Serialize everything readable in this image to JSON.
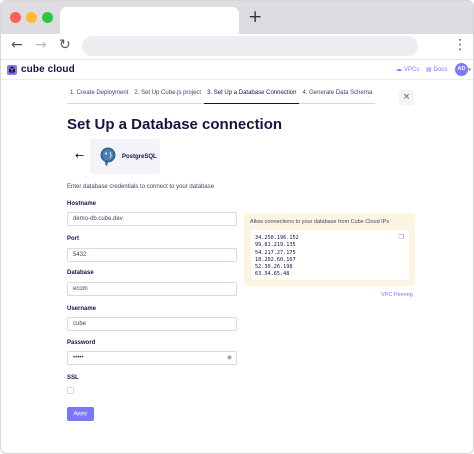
{
  "browser": {
    "new_tab": "+",
    "back": "←",
    "forward": "→",
    "reload": "↻",
    "menu": "⋮"
  },
  "header": {
    "logo_text": "cube cloud",
    "links": [
      {
        "label": "VPCs",
        "icon": "vpc-icon"
      },
      {
        "label": "Docs",
        "icon": "docs-icon"
      }
    ],
    "avatar": "AD"
  },
  "steps": [
    {
      "label": "1. Create Deployment",
      "active": false
    },
    {
      "label": "2. Set Up Cube.js project",
      "active": false
    },
    {
      "label": "3. Set Up a Database Connection",
      "active": true
    },
    {
      "label": "4. Generate Data Schema",
      "active": false
    }
  ],
  "close": "×",
  "title": "Set Up a Database connection",
  "database": {
    "name": "PostgreSQL",
    "back": "←"
  },
  "intro": "Enter database credentials to connect to your database",
  "fields": {
    "hostname": {
      "label": "Hostname",
      "value": "demo-db.cube.dev"
    },
    "port": {
      "label": "Port",
      "value": "5432"
    },
    "database": {
      "label": "Database",
      "value": "ecom"
    },
    "username": {
      "label": "Username",
      "value": "cube"
    },
    "password": {
      "label": "Password",
      "value": "•••••"
    },
    "ssl": {
      "label": "SSL",
      "checked": false
    }
  },
  "apply_label": "Apply",
  "ip_panel": {
    "title": "Allow connections to your database from Cube Cloud IPs",
    "ips": [
      "34.258.196.152",
      "99.81.219.135",
      "54.217.27.175",
      "18.202.60.167",
      "52.30.26.198",
      "63.34.65.48"
    ],
    "vpc_link": "VPC Peering"
  },
  "colors": {
    "accent": "#7a77ff",
    "text": "#141446",
    "panel": "#fcf5e2"
  }
}
